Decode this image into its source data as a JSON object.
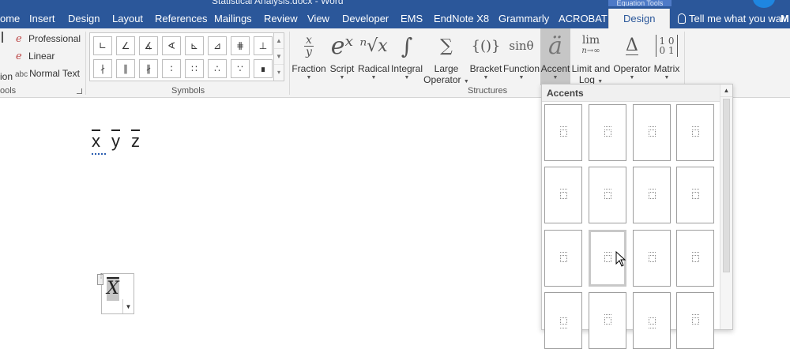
{
  "window": {
    "title": "Statistical Analysis.docx - Word",
    "context_tab_group": "Equation Tools"
  },
  "tabs": [
    "ome",
    "Insert",
    "Design",
    "Layout",
    "References",
    "Mailings",
    "Review",
    "View",
    "Developer",
    "EMS",
    "EndNote X8",
    "Grammarly",
    "ACROBAT"
  ],
  "active_tab": "Design",
  "tell_me": "Tell me what you war",
  "user_initial": "M",
  "tools": {
    "items": [
      "Professional",
      "Linear",
      "Normal Text"
    ],
    "partial_label": "ion",
    "group_label": "ools"
  },
  "symbols": {
    "group_label": "Symbols",
    "row1": [
      "∟",
      "∠",
      "∡",
      "∢",
      "⊾",
      "⊿",
      "⋕",
      "⊥"
    ],
    "row2": [
      "∤",
      "∥",
      "∦",
      "∶",
      "∷",
      "∴",
      "∵",
      "∎"
    ]
  },
  "structures": {
    "group_label": "Structures",
    "buttons": [
      {
        "label": "Fraction",
        "glyph": "x/y"
      },
      {
        "label": "Script",
        "glyph": "eˣ"
      },
      {
        "label": "Radical",
        "glyph": "ⁿ√x"
      },
      {
        "label": "Integral",
        "glyph": "∫"
      },
      {
        "label": "Large",
        "label2": "Operator",
        "glyph": "∑"
      },
      {
        "label": "Bracket",
        "glyph": "{()}"
      },
      {
        "label": "Function",
        "glyph": "sinθ"
      },
      {
        "label": "Accent",
        "glyph": "ä"
      },
      {
        "label": "Limit and",
        "label2": "Log",
        "glyph": "lim"
      },
      {
        "label": "Operator",
        "glyph": "Δ"
      },
      {
        "label": "Matrix",
        "glyph": "[10 01]"
      }
    ]
  },
  "document": {
    "variables": [
      "x",
      "y",
      "z"
    ],
    "equation_text": "X"
  },
  "accent_panel": {
    "title": "Accents",
    "rows": 4,
    "cols": 4,
    "hover_index": 9
  }
}
